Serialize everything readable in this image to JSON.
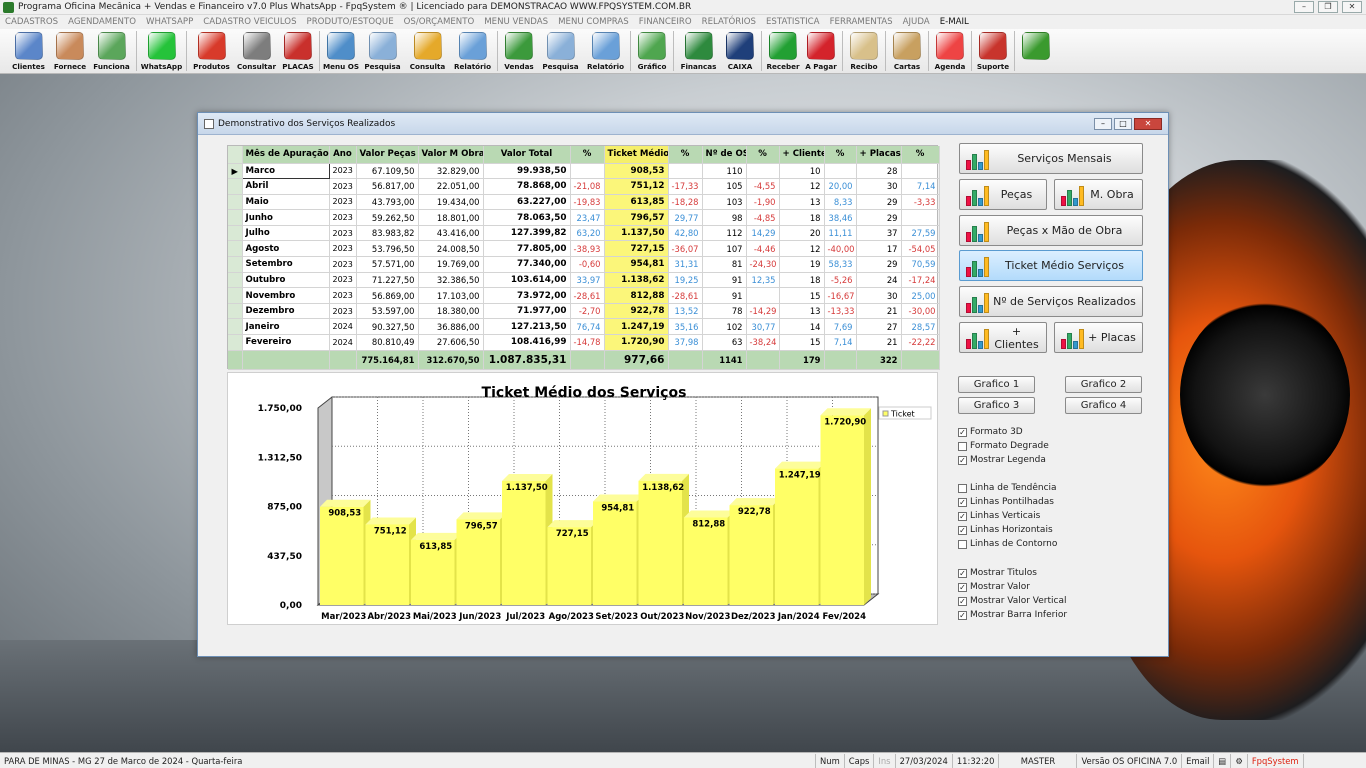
{
  "app": {
    "title": "Programa Oficina Mecânica + Vendas e Financeiro v7.0 Plus WhatsApp - FpqSystem ® | Licenciado para  DEMONSTRACAO WWW.FPQSYSTEM.COM.BR"
  },
  "menu": [
    "CADASTROS",
    "AGENDAMENTO",
    "WHATSAPP",
    "CADASTRO VEICULOS",
    "PRODUTO/ESTOQUE",
    "OS/ORÇAMENTO",
    "MENU VENDAS",
    "MENU COMPRAS",
    "FINANCEIRO",
    "RELATÓRIOS",
    "ESTATISTICA",
    "FERRAMENTAS",
    "AJUDA",
    "E-MAIL"
  ],
  "toolbar": [
    {
      "label": "Clientes",
      "color": "#5b86c9"
    },
    {
      "label": "Fornece",
      "color": "#c98a5b"
    },
    {
      "label": "Funciona",
      "color": "#5ba65b"
    },
    {
      "label": "WhatsApp",
      "color": "#25c33a"
    },
    {
      "label": "Produtos",
      "color": "#d83a2a"
    },
    {
      "label": "Consultar",
      "color": "#7d7d7d"
    },
    {
      "label": "PLACAS",
      "color": "#c9302c"
    },
    {
      "label": "Menu OS",
      "color": "#4f8ec9"
    },
    {
      "label": "Pesquisa",
      "color": "#8ab0d8"
    },
    {
      "label": "Consulta",
      "color": "#e5a92a"
    },
    {
      "label": "Relatório",
      "color": "#6aa0d8"
    },
    {
      "label": "Vendas",
      "color": "#3c9a3c"
    },
    {
      "label": "Pesquisa",
      "color": "#8ab0d8"
    },
    {
      "label": "Relatório",
      "color": "#6aa0d8"
    },
    {
      "label": "Gráfico",
      "color": "#4fa64f"
    },
    {
      "label": "Financas",
      "color": "#2e8a3e"
    },
    {
      "label": "CAIXA",
      "color": "#1f3f7a"
    },
    {
      "label": "Receber",
      "color": "#22a033"
    },
    {
      "label": "A Pagar",
      "color": "#d4232b"
    },
    {
      "label": "Recibo",
      "color": "#d8c08a"
    },
    {
      "label": "Cartas",
      "color": "#c8a060"
    },
    {
      "label": "Agenda",
      "color": "#e44"
    },
    {
      "label": "Suporte",
      "color": "#c8342c"
    },
    {
      "label": "",
      "color": "#3a9a2e"
    }
  ],
  "window": {
    "title": "Demonstrativo dos Serviços Realizados"
  },
  "table": {
    "headers": [
      "Mês de Apuração",
      "Ano",
      "Valor Peças",
      "Valor M Obra",
      "Valor Total",
      "%",
      "Ticket Médio",
      "%",
      "Nº de OS",
      "%",
      "+ Clientes",
      "%",
      "+ Placas",
      "%"
    ],
    "rows": [
      {
        "mes": "Marco",
        "ano": "2023",
        "pecas": "67.109,50",
        "mobra": "32.829,00",
        "total": "99.938,50",
        "p1": "",
        "ticket": "908,53",
        "p2": "",
        "os": "110",
        "p3": "",
        "cli": "10",
        "p4": "",
        "pla": "28",
        "p5": ""
      },
      {
        "mes": "Abril",
        "ano": "2023",
        "pecas": "56.817,00",
        "mobra": "22.051,00",
        "total": "78.868,00",
        "p1": "-21,08",
        "ticket": "751,12",
        "p2": "-17,33",
        "os": "105",
        "p3": "-4,55",
        "cli": "12",
        "p4": "20,00",
        "pla": "30",
        "p5": "7,14"
      },
      {
        "mes": "Maio",
        "ano": "2023",
        "pecas": "43.793,00",
        "mobra": "19.434,00",
        "total": "63.227,00",
        "p1": "-19,83",
        "ticket": "613,85",
        "p2": "-18,28",
        "os": "103",
        "p3": "-1,90",
        "cli": "13",
        "p4": "8,33",
        "pla": "29",
        "p5": "-3,33"
      },
      {
        "mes": "Junho",
        "ano": "2023",
        "pecas": "59.262,50",
        "mobra": "18.801,00",
        "total": "78.063,50",
        "p1": "23,47",
        "ticket": "796,57",
        "p2": "29,77",
        "os": "98",
        "p3": "-4,85",
        "cli": "18",
        "p4": "38,46",
        "pla": "29",
        "p5": ""
      },
      {
        "mes": "Julho",
        "ano": "2023",
        "pecas": "83.983,82",
        "mobra": "43.416,00",
        "total": "127.399,82",
        "p1": "63,20",
        "ticket": "1.137,50",
        "p2": "42,80",
        "os": "112",
        "p3": "14,29",
        "cli": "20",
        "p4": "11,11",
        "pla": "37",
        "p5": "27,59"
      },
      {
        "mes": "Agosto",
        "ano": "2023",
        "pecas": "53.796,50",
        "mobra": "24.008,50",
        "total": "77.805,00",
        "p1": "-38,93",
        "ticket": "727,15",
        "p2": "-36,07",
        "os": "107",
        "p3": "-4,46",
        "cli": "12",
        "p4": "-40,00",
        "pla": "17",
        "p5": "-54,05"
      },
      {
        "mes": "Setembro",
        "ano": "2023",
        "pecas": "57.571,00",
        "mobra": "19.769,00",
        "total": "77.340,00",
        "p1": "-0,60",
        "ticket": "954,81",
        "p2": "31,31",
        "os": "81",
        "p3": "-24,30",
        "cli": "19",
        "p4": "58,33",
        "pla": "29",
        "p5": "70,59"
      },
      {
        "mes": "Outubro",
        "ano": "2023",
        "pecas": "71.227,50",
        "mobra": "32.386,50",
        "total": "103.614,00",
        "p1": "33,97",
        "ticket": "1.138,62",
        "p2": "19,25",
        "os": "91",
        "p3": "12,35",
        "cli": "18",
        "p4": "-5,26",
        "pla": "24",
        "p5": "-17,24"
      },
      {
        "mes": "Novembro",
        "ano": "2023",
        "pecas": "56.869,00",
        "mobra": "17.103,00",
        "total": "73.972,00",
        "p1": "-28,61",
        "ticket": "812,88",
        "p2": "-28,61",
        "os": "91",
        "p3": "",
        "cli": "15",
        "p4": "-16,67",
        "pla": "30",
        "p5": "25,00"
      },
      {
        "mes": "Dezembro",
        "ano": "2023",
        "pecas": "53.597,00",
        "mobra": "18.380,00",
        "total": "71.977,00",
        "p1": "-2,70",
        "ticket": "922,78",
        "p2": "13,52",
        "os": "78",
        "p3": "-14,29",
        "cli": "13",
        "p4": "-13,33",
        "pla": "21",
        "p5": "-30,00"
      },
      {
        "mes": "Janeiro",
        "ano": "2024",
        "pecas": "90.327,50",
        "mobra": "36.886,00",
        "total": "127.213,50",
        "p1": "76,74",
        "ticket": "1.247,19",
        "p2": "35,16",
        "os": "102",
        "p3": "30,77",
        "cli": "14",
        "p4": "7,69",
        "pla": "27",
        "p5": "28,57"
      },
      {
        "mes": "Fevereiro",
        "ano": "2024",
        "pecas": "80.810,49",
        "mobra": "27.606,50",
        "total": "108.416,99",
        "p1": "-14,78",
        "ticket": "1.720,90",
        "p2": "37,98",
        "os": "63",
        "p3": "-38,24",
        "cli": "15",
        "p4": "7,14",
        "pla": "21",
        "p5": "-22,22"
      }
    ],
    "totals": {
      "pecas": "775.164,81",
      "mobra": "312.670,50",
      "total": "1.087.835,31",
      "ticket": "977,66",
      "os": "1141",
      "cli": "179",
      "pla": "322"
    }
  },
  "chart_data": {
    "type": "bar",
    "title": "Ticket Médio dos Serviços",
    "categories": [
      "Mar/2023",
      "Abr/2023",
      "Mai/2023",
      "Jun/2023",
      "Jul/2023",
      "Ago/2023",
      "Set/2023",
      "Out/2023",
      "Nov/2023",
      "Dez/2023",
      "Jan/2024",
      "Fev/2024"
    ],
    "series": [
      {
        "name": "Ticket",
        "values": [
          908.53,
          751.12,
          613.85,
          796.57,
          1137.5,
          727.15,
          954.81,
          1138.62,
          812.88,
          922.78,
          1247.19,
          1720.9
        ]
      }
    ],
    "value_labels": [
      "908,53",
      "751,12",
      "613,85",
      "796,57",
      "1.137,50",
      "727,15",
      "954,81",
      "1.138,62",
      "812,88",
      "922,78",
      "1.247,19",
      "1.720,90"
    ],
    "yticks": [
      0,
      437.5,
      875,
      1312.5,
      1750
    ],
    "ytick_labels": [
      "0,00",
      "437,50",
      "875,00",
      "1.312,50",
      "1.750,00"
    ],
    "ylim": [
      0,
      1750
    ],
    "bar_color": "#ffff66",
    "style": "3d",
    "grid": "dotted vertical and horizontal",
    "legend": "top-right"
  },
  "buttons": {
    "servicos_mensais": "Serviços Mensais",
    "pecas": "Peças",
    "mobra": "M. Obra",
    "pecas_mobra": "Peças x Mão de Obra",
    "ticket": "Ticket Médio Serviços",
    "num_servicos": "Nº de Serviços Realizados",
    "clientes": "+ Clientes",
    "placas": "+ Placas",
    "g1": "Grafico 1",
    "g2": "Grafico 2",
    "g3": "Grafico 3",
    "g4": "Grafico 4"
  },
  "options": [
    {
      "label": "Formato 3D",
      "checked": true
    },
    {
      "label": "Formato Degrade",
      "checked": false
    },
    {
      "label": "Mostrar Legenda",
      "checked": true
    },
    {
      "label": "Linha de Tendência",
      "checked": false
    },
    {
      "label": "Linhas Pontilhadas",
      "checked": true
    },
    {
      "label": "Linhas Verticais",
      "checked": true
    },
    {
      "label": "Linhas Horizontais",
      "checked": true
    },
    {
      "label": "Linhas de Contorno",
      "checked": false
    },
    {
      "label": "Mostrar Titulos",
      "checked": true
    },
    {
      "label": "Mostrar Valor",
      "checked": true
    },
    {
      "label": "Mostrar Valor Vertical",
      "checked": true
    },
    {
      "label": "Mostrar Barra Inferior",
      "checked": true
    }
  ],
  "status": {
    "location": "PARA DE MINAS - MG 27 de Marco de 2024 - Quarta-feira",
    "num": "Num",
    "caps": "Caps",
    "ins": "Ins",
    "date": "27/03/2024",
    "time": "11:32:20",
    "user": "MASTER",
    "version": "Versão OS OFICINA 7.0",
    "email": "Email",
    "brand": "FpqSystem"
  }
}
